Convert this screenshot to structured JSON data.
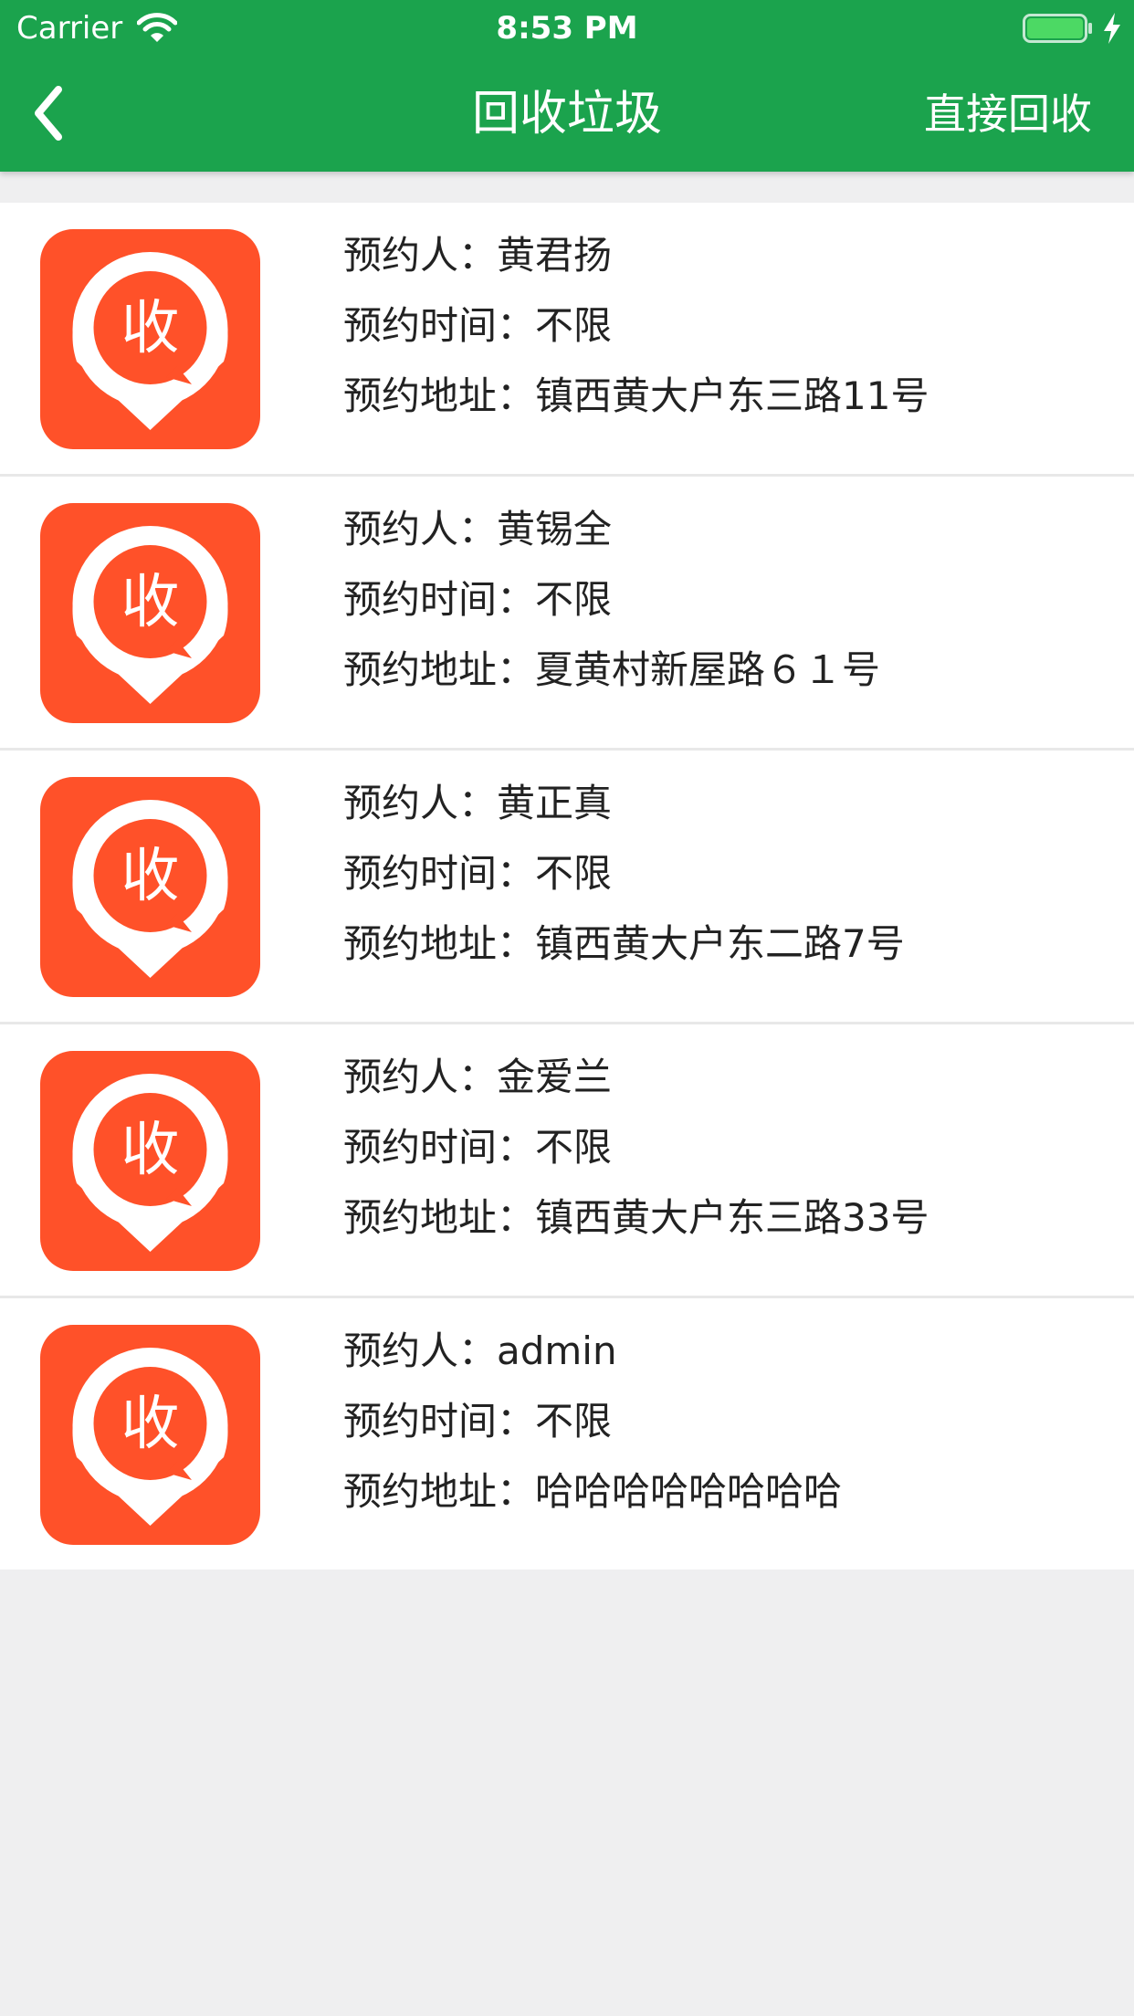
{
  "status_bar": {
    "carrier": "Carrier",
    "time": "8:53 PM"
  },
  "nav": {
    "title": "回收垃圾",
    "action_label": "直接回收",
    "back_icon": "chevron-left-icon"
  },
  "colors": {
    "nav_background": "#1ba34d",
    "icon_orange": "#ff5129",
    "page_background": "#efeff0"
  },
  "list": {
    "items": [
      {
        "name_line": "预约人：黄君扬",
        "time_line": "预约时间：不限",
        "address_line": "预约地址：镇西黄大户东三路11号",
        "icon_char": "收"
      },
      {
        "name_line": "预约人：黄锡全",
        "time_line": "预约时间：不限",
        "address_line": "预约地址：夏黄村新屋路６１号",
        "icon_char": "收"
      },
      {
        "name_line": "预约人：黄正真",
        "time_line": "预约时间：不限",
        "address_line": "预约地址：镇西黄大户东二路7号",
        "icon_char": "收"
      },
      {
        "name_line": "预约人：金爱兰",
        "time_line": "预约时间：不限",
        "address_line": "预约地址：镇西黄大户东三路33号",
        "icon_char": "收"
      },
      {
        "name_line": "预约人：admin",
        "time_line": "预约时间：不限",
        "address_line": "预约地址：哈哈哈哈哈哈哈哈",
        "icon_char": "收"
      }
    ]
  }
}
